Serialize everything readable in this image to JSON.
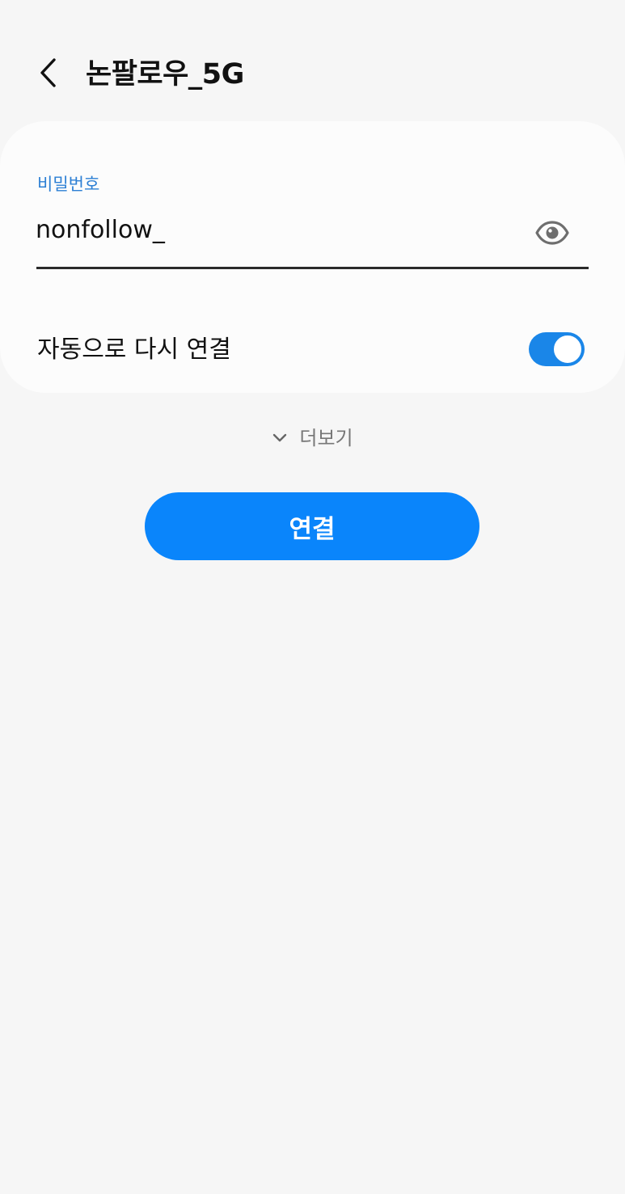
{
  "header": {
    "title": "논팔로우_5G",
    "back_icon": "chevron-left-icon"
  },
  "form": {
    "password_label": "비밀번호",
    "password_value": "nonfollow_",
    "visibility_icon": "eye-icon",
    "auto_reconnect_label": "자동으로 다시 연결",
    "auto_reconnect_enabled": true
  },
  "more": {
    "icon": "chevron-down-icon",
    "label": "더보기"
  },
  "actions": {
    "connect_label": "연결"
  },
  "colors": {
    "background": "#f6f6f6",
    "card": "#fcfcfc",
    "accent": "#0a85fb",
    "label_blue": "#2c7fd4",
    "toggle_on": "#1a86e8"
  }
}
